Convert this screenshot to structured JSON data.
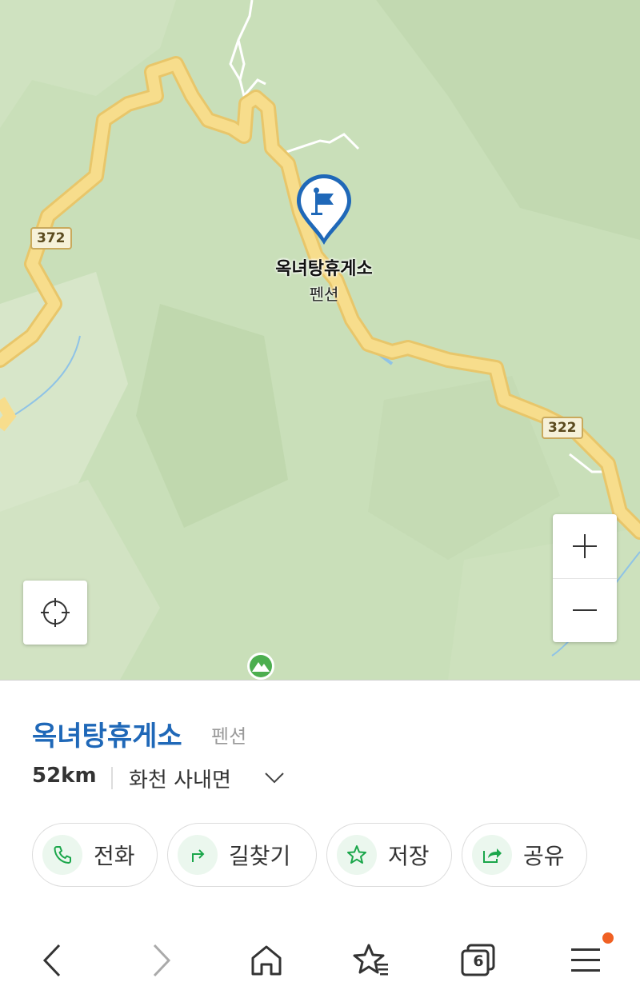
{
  "map": {
    "place_label": "옥녀탕휴게소",
    "place_category_label": "펜션",
    "route_shields": [
      "372",
      "322"
    ],
    "colors": {
      "terrain": "#c9dfb9",
      "road": "#f7dd8c",
      "road_casing": "#e8c66a",
      "pin": "#1f68b8",
      "river": "#8fc3e6"
    },
    "icons": {
      "pin": "flag-pin-icon",
      "locate": "crosshair-icon",
      "zoom_in": "plus-icon",
      "zoom_out": "minus-icon",
      "poi": "mountain-icon"
    }
  },
  "sheet": {
    "name": "옥녀탕휴게소",
    "category": "펜션",
    "distance": "52km",
    "region": "화천 사내면",
    "actions": [
      {
        "label": "전화",
        "icon": "phone-icon"
      },
      {
        "label": "길찾기",
        "icon": "directions-icon"
      },
      {
        "label": "저장",
        "icon": "star-icon"
      },
      {
        "label": "공유",
        "icon": "share-icon"
      }
    ],
    "accent_color": "#1f68b8",
    "action_icon_color": "#1aa64a"
  },
  "browser_nav": {
    "tabs_count": "6",
    "icons": [
      "back-icon",
      "forward-icon",
      "home-icon",
      "bookmarks-icon",
      "tabs-icon",
      "menu-icon"
    ]
  }
}
